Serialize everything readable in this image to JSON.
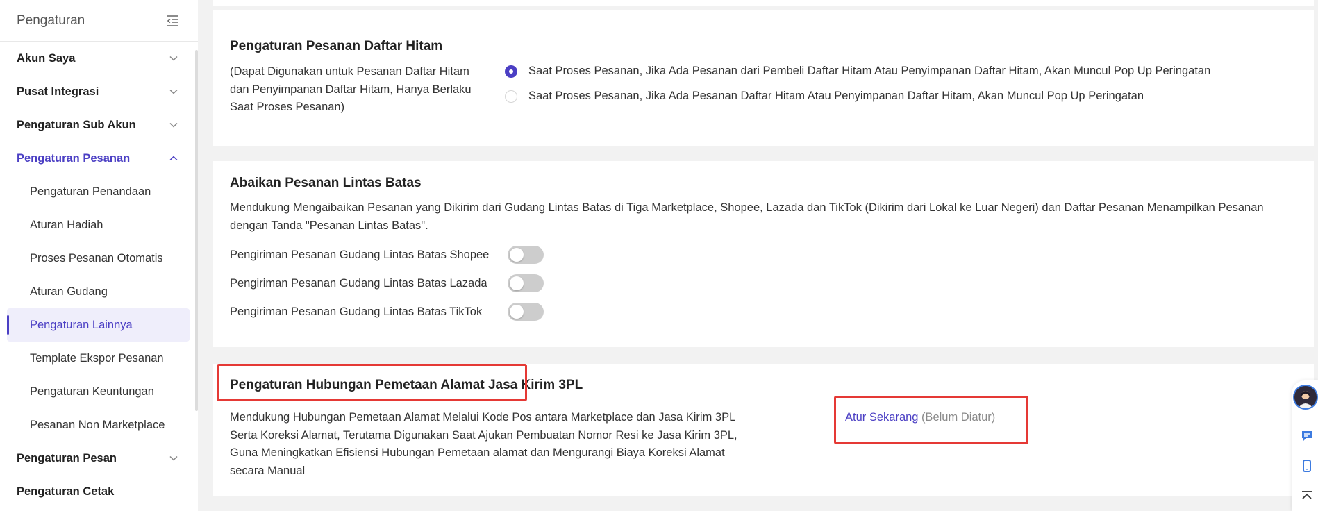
{
  "sidebar": {
    "title": "Pengaturan",
    "groups": [
      {
        "label": "Akun Saya"
      },
      {
        "label": "Pusat Integrasi"
      },
      {
        "label": "Pengaturan Sub Akun"
      },
      {
        "label": "Pengaturan Pesanan"
      },
      {
        "label": "Pengaturan Pesan"
      },
      {
        "label": "Pengaturan Cetak"
      }
    ],
    "sub_items": [
      {
        "label": "Pengaturan Penandaan"
      },
      {
        "label": "Aturan Hadiah"
      },
      {
        "label": "Proses Pesanan Otomatis"
      },
      {
        "label": "Aturan Gudang"
      },
      {
        "label": "Pengaturan Lainnya"
      },
      {
        "label": "Template Ekspor Pesanan"
      },
      {
        "label": "Pengaturan Keuntungan"
      },
      {
        "label": "Pesanan Non Marketplace"
      }
    ],
    "active_item": "Pengaturan Lainnya"
  },
  "blacklist": {
    "title": "Pengaturan Pesanan Daftar Hitam",
    "description": "(Dapat Digunakan untuk Pesanan Daftar Hitam dan Penyimpanan Daftar Hitam, Hanya Berlaku Saat Proses Pesanan)",
    "options": [
      {
        "label": "Saat Proses Pesanan, Jika Ada Pesanan dari Pembeli Daftar Hitam Atau Penyimpanan Daftar Hitam, Akan Muncul Pop Up Peringatan",
        "selected": true
      },
      {
        "label": "Saat Proses Pesanan, Jika Ada Pesanan Daftar Hitam Atau Penyimpanan Daftar Hitam, Akan Muncul Pop Up Peringatan",
        "selected": false
      }
    ]
  },
  "crossborder": {
    "title": "Abaikan Pesanan Lintas Batas",
    "description": "Mendukung Mengaibaikan Pesanan yang Dikirim dari Gudang Lintas Batas di Tiga Marketplace, Shopee, Lazada dan TikTok (Dikirim dari Lokal ke Luar Negeri) dan Daftar Pesanan Menampilkan Pesanan dengan Tanda \"Pesanan Lintas Batas\".",
    "toggles": [
      {
        "label": "Pengiriman Pesanan Gudang Lintas Batas Shopee",
        "on": false
      },
      {
        "label": "Pengiriman Pesanan Gudang Lintas Batas Lazada",
        "on": false
      },
      {
        "label": "Pengiriman Pesanan Gudang Lintas Batas TikTok",
        "on": false
      }
    ]
  },
  "mapping": {
    "title": "Pengaturan Hubungan Pemetaan Alamat Jasa Kirim 3PL",
    "description": "Mendukung Hubungan Pemetaan Alamat Melalui Kode Pos antara Marketplace dan Jasa Kirim 3PL Serta Koreksi Alamat, Terutama Digunakan Saat Ajukan Pembuatan Nomor Resi ke Jasa Kirim 3PL, Guna Meningkatkan Efisiensi Hubungan Pemetaan alamat dan Mengurangi Biaya Koreksi Alamat secara Manual",
    "action_label": "Atur Sekarang",
    "status": "(Belum Diatur)"
  },
  "colors": {
    "accent": "#4b3fc4",
    "highlight": "#e53935",
    "toggle_off": "#cdcdcd"
  }
}
